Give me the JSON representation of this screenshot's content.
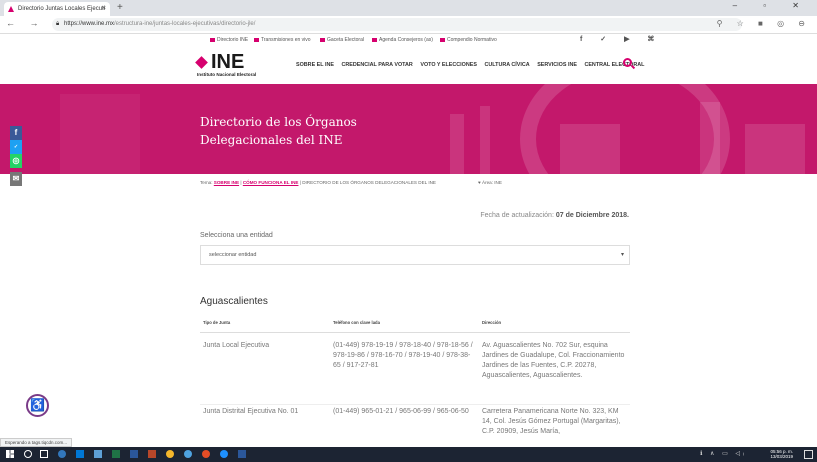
{
  "browser": {
    "tab_title": "Directorio Juntas Locales Ejecuti",
    "tab_close": "×",
    "new_tab": "+",
    "window_controls": "– ▫ ✕",
    "nav_buttons": "← → C",
    "url_domain": "https://www.ine.mx",
    "url_path": "/estructura-ine/juntas-locales-ejecutivas/directorio-jle/",
    "toolbar_icons": "⚲ ☆ ■ ◎ ⊖",
    "status_text": "Esperando a tags.tiqcdn.com..."
  },
  "utility_bar": {
    "items": [
      "Directorio INE",
      "Transmisiones en vivo",
      "Gaceta Electoral",
      "Agenda Consejeros (as)",
      "Compendio Normativo"
    ],
    "social": "f ✓ ▶ ⌘"
  },
  "header": {
    "logo_text": "INE",
    "logo_subtitle": "Instituto Nacional Electoral",
    "nav": [
      "SOBRE EL INE",
      "CREDENCIAL PARA VOTAR",
      "VOTO Y ELECCIONES",
      "CULTURA CÍVICA",
      "SERVICIOS INE",
      "CENTRAL ELECTORAL"
    ],
    "search_icon": "search-icon"
  },
  "hero": {
    "title": "Directorio de los Órganos Delegacionales del INE"
  },
  "breadcrumb": {
    "prefix": "Tema: ",
    "link1": "SOBRE INE",
    "sep": " | ",
    "link2": "CÓMO FUNCIONA EL INE",
    "current": " | DIRECTORIO DE LOS ÓRGANOS DELEGACIONALES DEL INE",
    "area": "♥ Área: INE"
  },
  "social_sidebar": [
    "f",
    "in",
    "✓",
    "◎",
    "✉"
  ],
  "content": {
    "fecha_label": "Fecha de actualización: ",
    "fecha_value": "07 de Diciembre 2018.",
    "select_label": "Selecciona una entidad",
    "select_value": "seleccionar entidad",
    "select_caret": "▾",
    "state_title": "Aguascalientes",
    "columns": [
      "Tipo de Junta",
      "Teléfono con clave lada",
      "Dirección"
    ],
    "rows": [
      {
        "tipo": "Junta Local Ejecutiva",
        "telefono": "(01-449) 978-19-19 / 978-18-40 / 978-18-56 / 978-19-86 / 978-16-70 / 978-19-40 / 978-38-65 / 917-27-81",
        "direccion": "Av. Aguascalientes No. 702 Sur, esquina Jardines de Guadalupe, Col. Fraccionamiento Jardines de las Fuentes, C.P. 20278, Aguascalientes, Aguascalientes."
      },
      {
        "tipo": "Junta Distrital Ejecutiva No. 01",
        "telefono": "(01-449) 965-01-21 / 965-06-99 / 965-06-50",
        "direccion": "Carretera Panamericana Norte No. 323, KM 14, Col. Jesús Gómez Portugal (Margaritas), C.P. 20909, Jesús María,"
      }
    ]
  },
  "accessibility": "♿",
  "taskbar": {
    "time": "05:56 p. m.",
    "date": "13/03/2019",
    "tray": "ℹ ∧ ▭ ◁ᵢ"
  },
  "colors": {
    "brand": "#d6006e",
    "hero": "#c3186b"
  }
}
